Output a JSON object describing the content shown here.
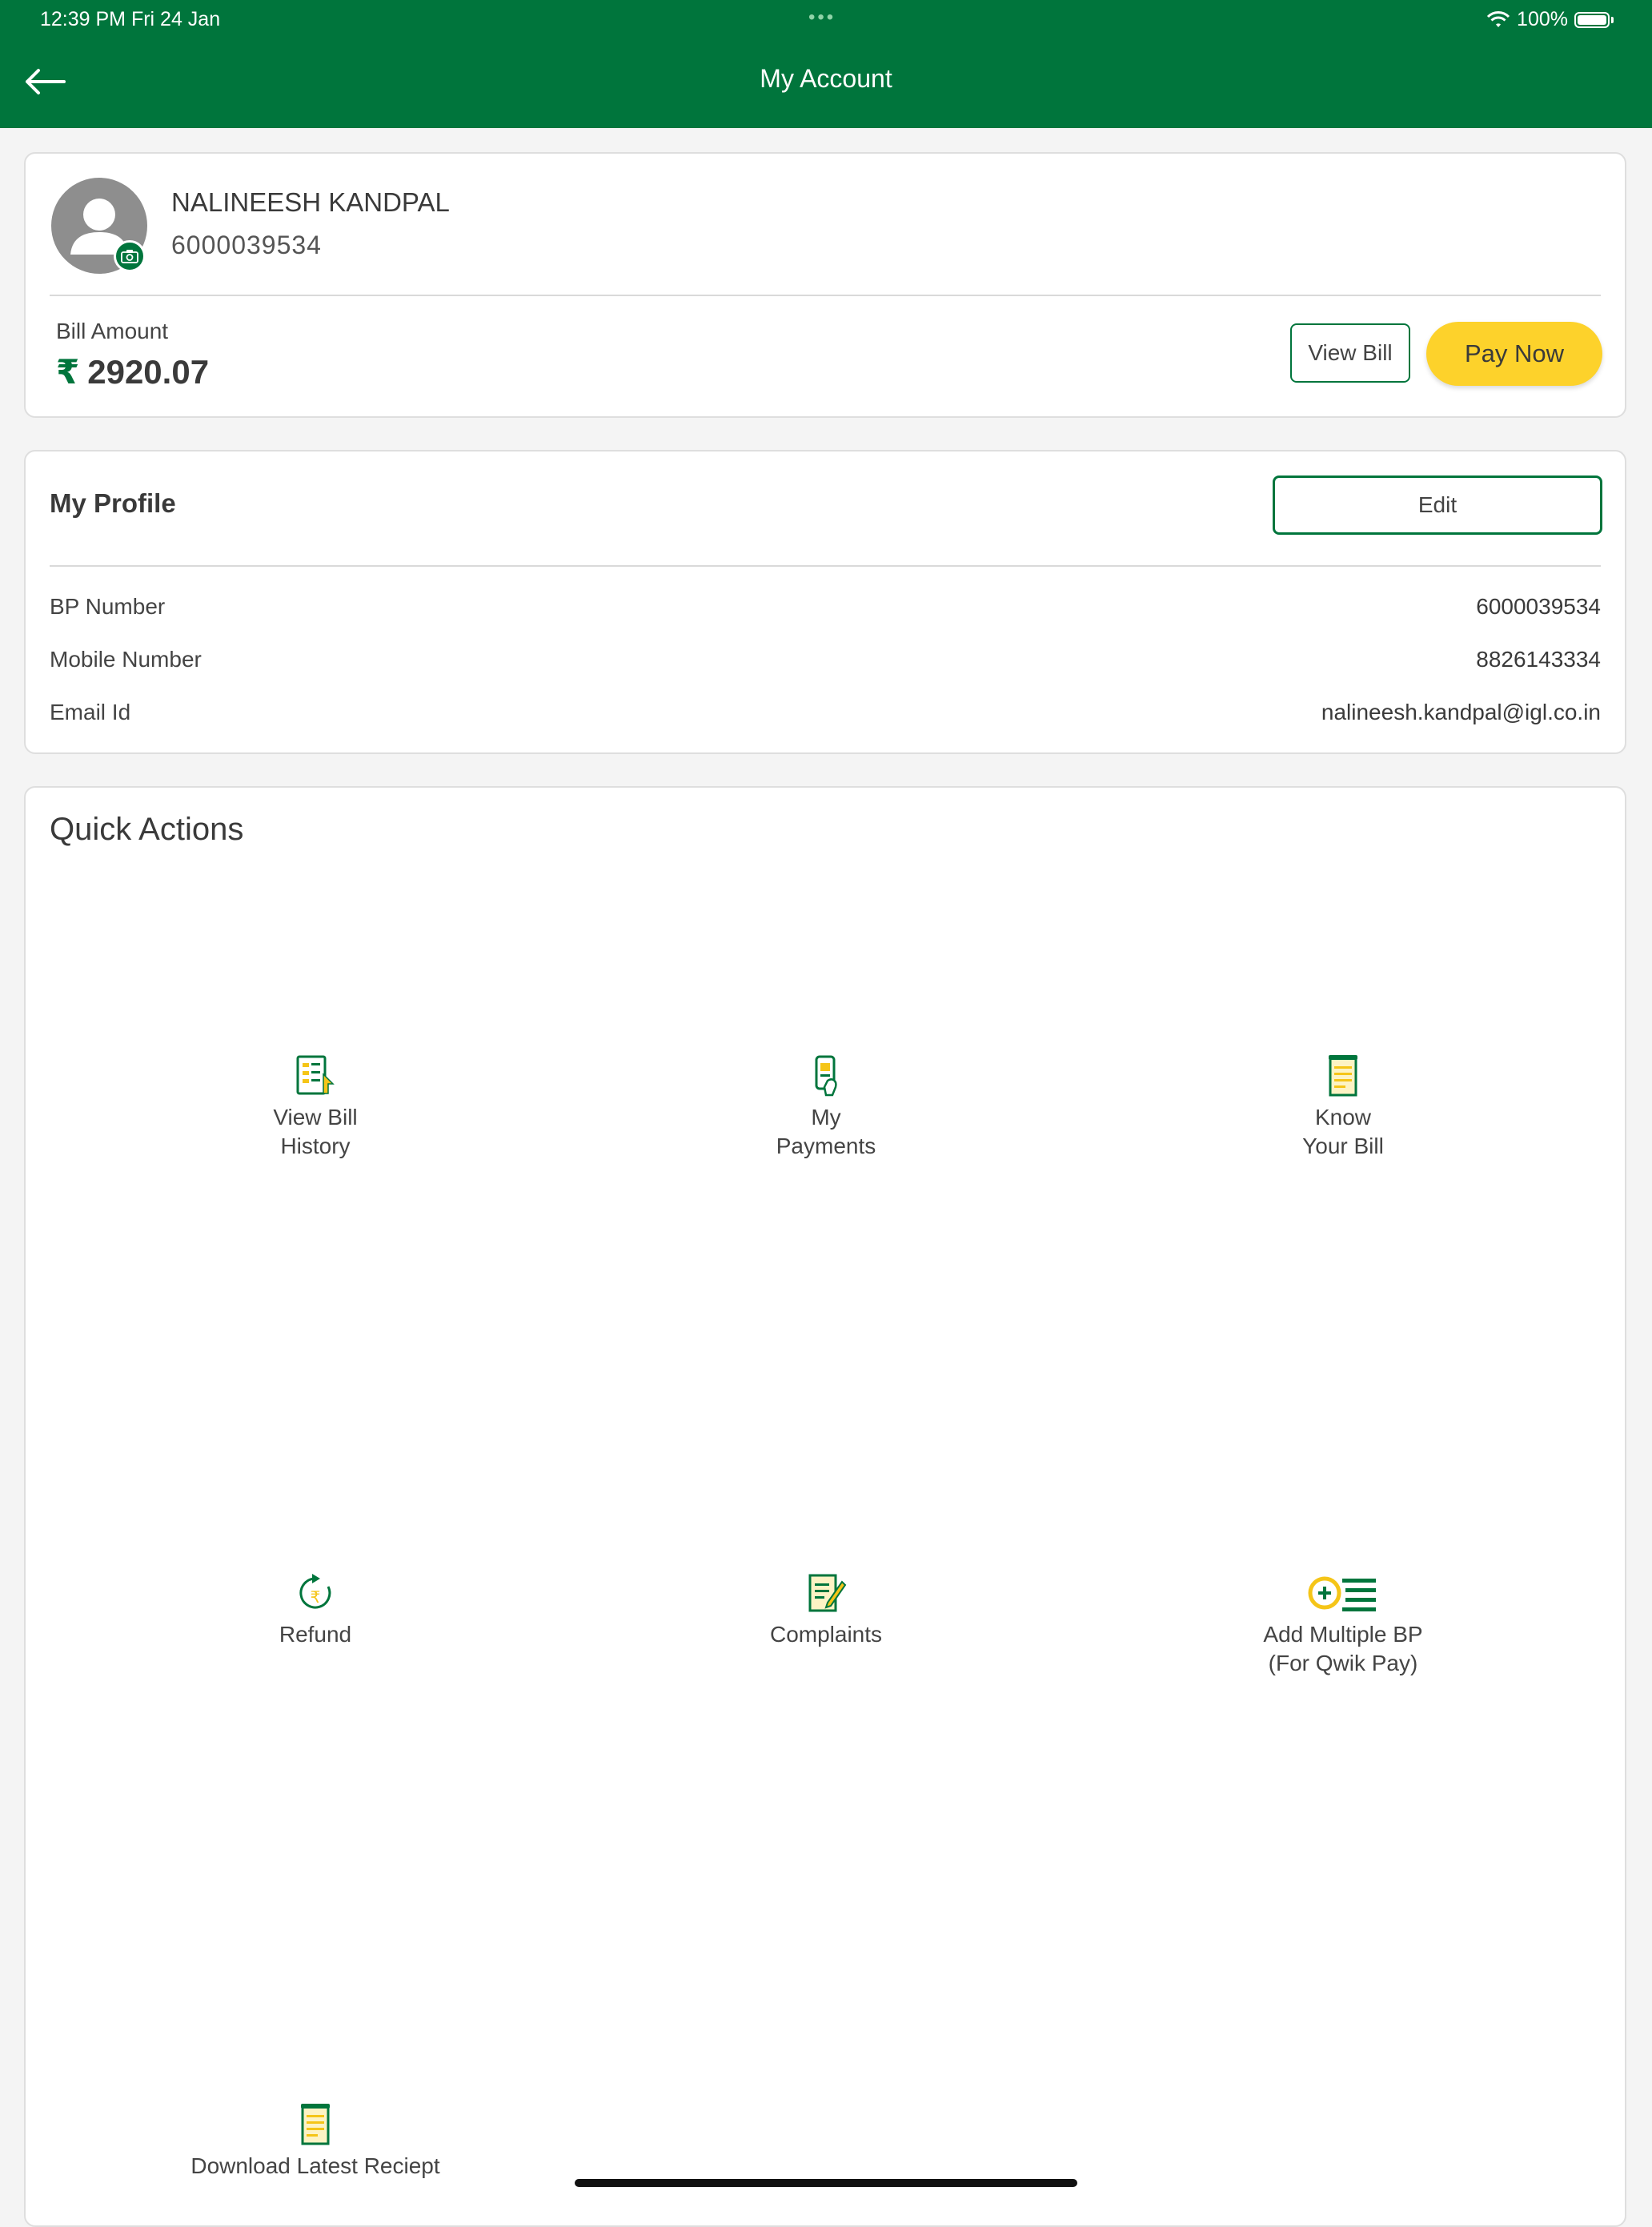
{
  "status_bar": {
    "time": "12:39 PM   Fri 24 Jan",
    "battery": "100%"
  },
  "header": {
    "title": "My Account"
  },
  "account": {
    "name": "NALINEESH KANDPAL",
    "bp_number": "6000039534",
    "bill_label": "Bill Amount",
    "currency_symbol": "₹",
    "bill_amount": "2920.07",
    "view_bill_label": "View Bill",
    "pay_now_label": "Pay Now"
  },
  "profile": {
    "title": "My Profile",
    "edit_label": "Edit",
    "rows": [
      {
        "label": "BP Number",
        "value": "6000039534"
      },
      {
        "label": "Mobile Number",
        "value": "8826143334"
      },
      {
        "label": "Email Id",
        "value": "nalineesh.kandpal@igl.co.in"
      }
    ]
  },
  "quick_actions": {
    "title": "Quick Actions",
    "items": [
      {
        "label": "View Bill\nHistory",
        "icon": "bill-history-icon"
      },
      {
        "label": "My\nPayments",
        "icon": "mobile-payment-icon"
      },
      {
        "label": "Know\nYour Bill",
        "icon": "bill-receipt-icon"
      },
      {
        "label": "Refund",
        "icon": "refund-icon"
      },
      {
        "label": "Complaints",
        "icon": "complaint-icon"
      },
      {
        "label": "Add Multiple BP\n(For Qwik Pay)",
        "icon": "add-list-icon"
      },
      {
        "label": "Download Latest Reciept",
        "icon": "receipt-download-icon"
      }
    ]
  },
  "colors": {
    "brand_green": "#00753c",
    "accent_yellow": "#fdd22b"
  }
}
